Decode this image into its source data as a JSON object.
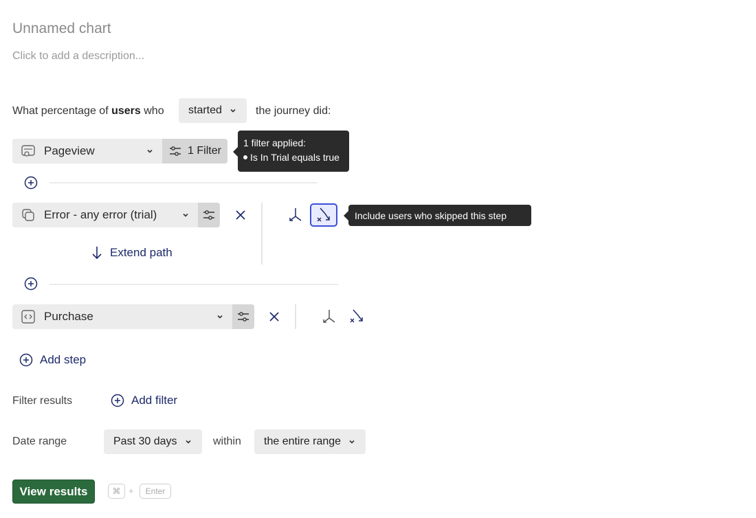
{
  "chart": {
    "title": "Unnamed chart",
    "description_placeholder": "Click to add a description..."
  },
  "question": {
    "prefix": "What percentage of ",
    "subject": "users",
    "middle": " who",
    "mode": "started",
    "suffix": "the journey did:"
  },
  "steps": [
    {
      "label": "Pageview",
      "filter_label": "1 Filter"
    },
    {
      "label": "Error - any error (trial)"
    },
    {
      "label": "Purchase"
    }
  ],
  "extend_path_label": "Extend path",
  "filter_tooltip": {
    "title": "1 filter applied:",
    "item": "Is In Trial equals true"
  },
  "skip_tooltip": "Include users who skipped this step",
  "add_step_label": "Add step",
  "filter_results": {
    "label": "Filter results",
    "add_filter": "Add filter"
  },
  "date_range": {
    "label": "Date range",
    "value": "Past 30 days",
    "within": "within",
    "window": "the entire range"
  },
  "view_results": "View results",
  "shortcut": {
    "modifier": "⌘",
    "plus": "+",
    "key": "Enter"
  },
  "colors": {
    "accent": "#1d2a6b",
    "primary_button": "#2b6a3c",
    "highlight": "#3b4fd8"
  }
}
